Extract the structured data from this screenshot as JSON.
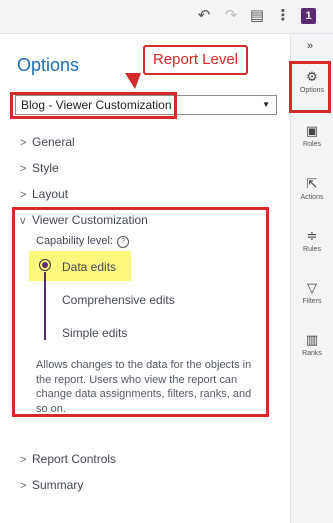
{
  "toolbar": {
    "undo_icon": "undo-icon",
    "redo_icon": "redo-icon",
    "pages_icon": "pages-icon",
    "more_icon": "more-icon",
    "badge": "1"
  },
  "panel": {
    "title": "Options",
    "callout": "Report Level",
    "select": {
      "value": "Blog - Viewer Customization"
    },
    "sections": {
      "general": "General",
      "style": "Style",
      "layout": "Layout",
      "viewer_customization": "Viewer Customization",
      "report_controls": "Report Controls",
      "summary": "Summary"
    },
    "capability": {
      "label": "Capability level:",
      "options": [
        "Data edits",
        "Comprehensive edits",
        "Simple edits"
      ],
      "selected": "Data edits",
      "description": "Allows changes to the data for the objects in the report. Users who view the report can change data assignments, filters, ranks, and so on."
    }
  },
  "rail": {
    "collapse": "»",
    "items": [
      "Options",
      "Roles",
      "Actions",
      "Rules",
      "Filters",
      "Ranks"
    ]
  },
  "colors": {
    "accent": "#1f6db3",
    "annotation_red": "#d42a2a",
    "highlight": "#fbf87d",
    "purple": "#5a2a73"
  }
}
